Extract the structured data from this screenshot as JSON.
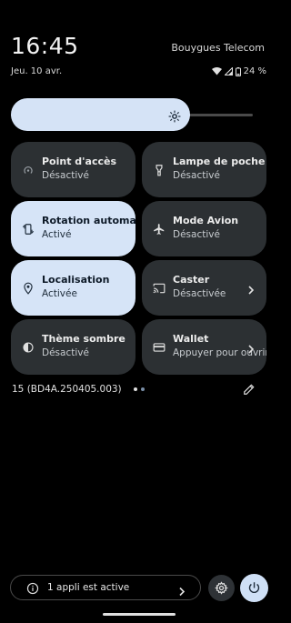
{
  "status": {
    "time": "16:45",
    "carrier": "Bouygues Telecom",
    "date": "Jeu. 10 avr.",
    "battery": "24 %",
    "icons": [
      "wifi-icon",
      "signal-icon",
      "battery-icon"
    ]
  },
  "brightness": {
    "level": 0.78,
    "icon": "brightness-icon"
  },
  "tiles": [
    {
      "label": "Point d'accès",
      "sub": "Désactivé",
      "icon": "hotspot-icon",
      "active": false
    },
    {
      "label": "Lampe de poche",
      "sub": "Désactivé",
      "icon": "flashlight-icon",
      "active": false
    },
    {
      "label": "Rotation automatique",
      "sub": "Activé",
      "icon": "auto-rotate-icon",
      "active": true
    },
    {
      "label": "Mode Avion",
      "sub": "Désactivé",
      "icon": "airplane-icon",
      "active": false
    },
    {
      "label": "Localisation",
      "sub": "Activée",
      "icon": "location-icon",
      "active": true
    },
    {
      "label": "Caster",
      "sub": "Désactivée",
      "icon": "cast-icon",
      "active": false
    },
    {
      "label": "Thème sombre",
      "sub": "Désactivé",
      "icon": "dark-theme-icon",
      "active": false
    },
    {
      "label": "Wallet",
      "sub": "Appuyer pour ouvrir",
      "icon": "wallet-icon",
      "active": false
    }
  ],
  "footer": {
    "build": "15 (BD4A.250405.003)",
    "page_index": 0,
    "page_count": 2
  },
  "bottom": {
    "active_apps": "1 appli est active"
  },
  "colors": {
    "accent": "#d6e4f7",
    "tile_off": "#2c3033",
    "background": "#000000"
  }
}
